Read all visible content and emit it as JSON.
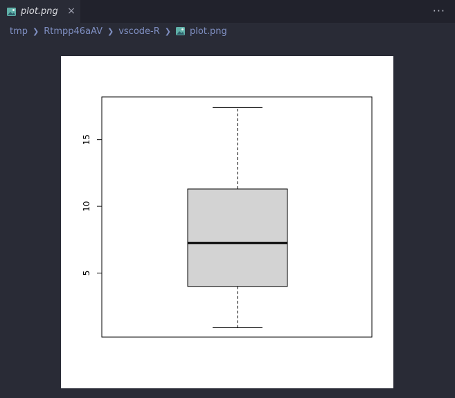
{
  "tab": {
    "label": "plot.png",
    "icon": "image-file-icon",
    "close": "×"
  },
  "toolbar": {
    "more": "···"
  },
  "breadcrumb": {
    "items": [
      "tmp",
      "Rtmpp46aAV",
      "vscode-R",
      "plot.png"
    ],
    "file_icon": "image-file-icon"
  },
  "colors": {
    "box_fill": "#d3d3d3",
    "editor_bg": "#292b36",
    "accent": "#7f8fc2"
  },
  "chart_data": {
    "type": "box",
    "yticks": [
      "5",
      "10",
      "15"
    ],
    "ylim": [
      0.2,
      18.2
    ],
    "box": {
      "min": 0.9,
      "q1": 4.0,
      "median": 7.25,
      "q3": 11.3,
      "max": 17.4
    },
    "grid": false,
    "title": "",
    "xlabel": "",
    "ylabel": ""
  }
}
